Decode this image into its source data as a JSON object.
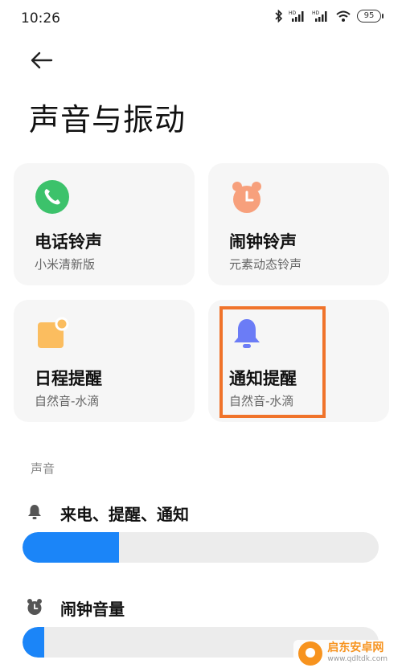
{
  "status_bar": {
    "time": "10:26",
    "battery": "95",
    "icons": [
      "bluetooth-icon",
      "signal-hd-icon",
      "signal-hd-icon",
      "wifi-icon",
      "battery-icon"
    ]
  },
  "header": {
    "back_icon": "arrow-left-icon",
    "title": "声音与振动"
  },
  "cards": [
    {
      "title": "电话铃声",
      "subtitle": "小米清新版",
      "icon": "phone-icon",
      "color": "#3cc26b"
    },
    {
      "title": "闹钟铃声",
      "subtitle": "元素动态铃声",
      "icon": "alarm-clock-icon",
      "color": "#f7a07c"
    },
    {
      "title": "日程提醒",
      "subtitle": "自然音-水滴",
      "icon": "calendar-note-icon",
      "color": "#fbbd5f"
    },
    {
      "title": "通知提醒",
      "subtitle": "自然音-水滴",
      "icon": "bell-icon",
      "color": "#6b7cf6"
    }
  ],
  "highlight": {
    "target": "通知提醒",
    "color": "#f0732a"
  },
  "sound_section": {
    "label": "声音",
    "rows": [
      {
        "label": "来电、提醒、通知",
        "icon": "bell-icon",
        "level": 0.27
      },
      {
        "label": "闹钟音量",
        "icon": "alarm-clock-icon",
        "level": 0.06
      }
    ],
    "accent": "#1b85f8"
  },
  "watermark": {
    "main": "启东安卓网",
    "sub": "www.qdltdk.com"
  }
}
